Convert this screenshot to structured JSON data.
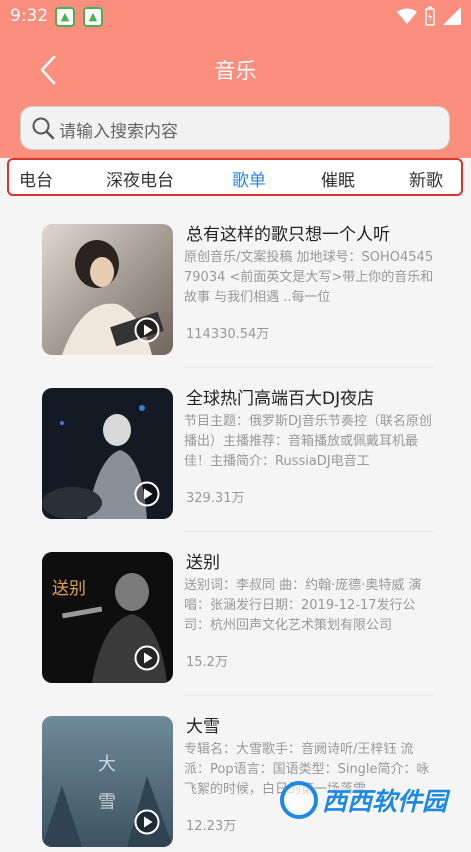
{
  "status_bar": {
    "time": "9:32",
    "app_icons": [
      "app-icon",
      "app-icon"
    ]
  },
  "header": {
    "title": "音乐",
    "back_icon": "chevron-left-icon"
  },
  "search": {
    "placeholder": "请输入搜索内容",
    "icon": "search-icon"
  },
  "tabs": [
    {
      "label": "电台",
      "active": false
    },
    {
      "label": "深夜电台",
      "active": false
    },
    {
      "label": "歌单",
      "active": true
    },
    {
      "label": "催眠",
      "active": false
    },
    {
      "label": "新歌",
      "active": false
    }
  ],
  "playlists": [
    {
      "title": "总有这样的歌只想一个人听",
      "desc": "原创音乐/文案投稿 加地球号：SOHO454579034 <前面英文是大写>带上你的音乐和故事 与我们相遇 ..每一位",
      "plays": "114330.54万"
    },
    {
      "title": "全球热门高端百大DJ夜店",
      "desc": "节目主题：俄罗斯DJ音乐节奏控（联名原创播出）主播推荐：音箱播放或佩戴耳机最佳！主播简介：RussiaDJ电音工",
      "plays": "329.31万"
    },
    {
      "title": "送别",
      "desc": "送别词：李叔同 曲：约翰·庞德·奥特威 演唱：张涵发行日期：2019-12-17发行公司：杭州回声文化艺术策划有限公司",
      "plays": "15.2万",
      "cover_text": "送别"
    },
    {
      "title": "大雪",
      "desc": "专辑名：大雪歌手：音阙诗听/王梓钰 流派：Pop语言：国语类型：Single简介：咏飞絮的时候，白日的第一场落雪",
      "plays": "12.23万",
      "cover_text": "大雪"
    }
  ],
  "watermark": {
    "text": "西西软件园"
  },
  "colors": {
    "header": "#fb8e7c",
    "tab_active": "#2e86de",
    "tab_border": "#d9342a"
  }
}
